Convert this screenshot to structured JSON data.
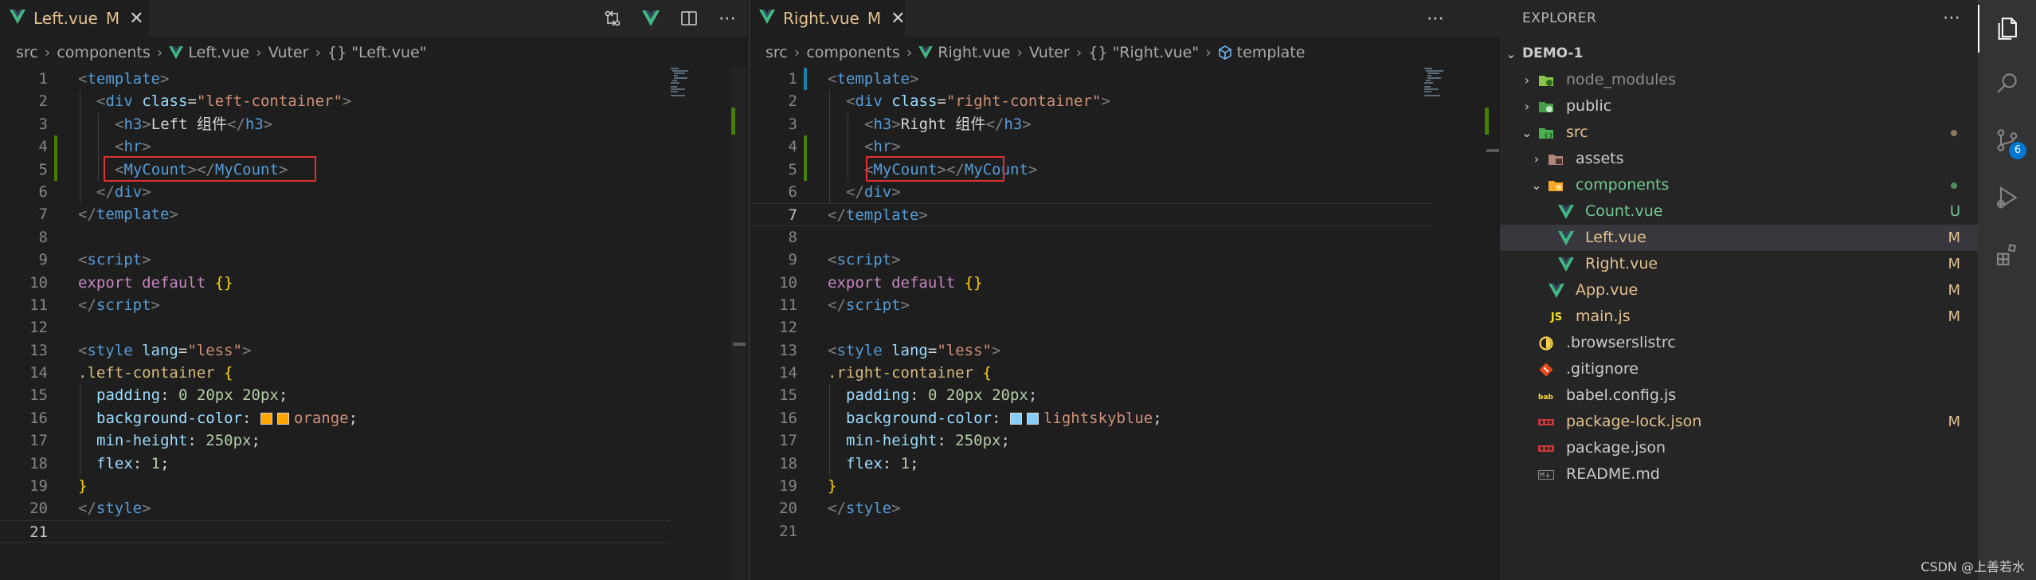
{
  "left_editor": {
    "tab": {
      "filename": "Left.vue",
      "status": "M",
      "close": "✕"
    },
    "actions_more": "⋯",
    "breadcrumb": {
      "src": "src",
      "components": "components",
      "file": "Left.vue",
      "vuter": "Vuter",
      "symbol_brace": "{}",
      "symbol": "\"Left.vue\""
    },
    "line_numbers": [
      "1",
      "2",
      "3",
      "4",
      "5",
      "6",
      "7",
      "8",
      "9",
      "10",
      "11",
      "12",
      "13",
      "14",
      "15",
      "16",
      "17",
      "18",
      "19",
      "20",
      "21"
    ],
    "code": {
      "l1": {
        "p1": "<",
        "tag": "template",
        "p2": ">"
      },
      "l2": {
        "p1": "<",
        "tag": "div",
        "attr": "class",
        "eq": "=",
        "val": "\"left-container\"",
        "p2": ">"
      },
      "l3": {
        "p1": "<",
        "tag": "h3",
        "p2": ">",
        "text": "Left 组件",
        "p3": "</",
        "tag2": "h3",
        "p4": ">"
      },
      "l4": {
        "p1": "<",
        "tag": "hr",
        "p2": ">"
      },
      "l5": {
        "p1": "<",
        "tag": "MyCount",
        "p2": "></",
        "tag2": "MyCount",
        "p3": ">"
      },
      "l6": {
        "p1": "</",
        "tag": "div",
        "p2": ">"
      },
      "l7": {
        "p1": "</",
        "tag": "template",
        "p2": ">"
      },
      "l9": {
        "p1": "<",
        "tag": "script",
        "p2": ">"
      },
      "l10": {
        "k1": "export",
        "k2": "default",
        "brace": "{}"
      },
      "l11": {
        "p1": "</",
        "tag": "script",
        "p2": ">"
      },
      "l13": {
        "p1": "<",
        "tag": "style",
        "attr": "lang",
        "eq": "=",
        "val": "\"less\"",
        "p2": ">"
      },
      "l14": {
        "sel": ".left-container",
        "brace": "{"
      },
      "l15": {
        "prop": "padding",
        "colon": ":",
        "v1": "0",
        "v2": "20px",
        "v3": "20px",
        "semi": ";"
      },
      "l16": {
        "prop": "background-color",
        "colon": ":",
        "val": "orange",
        "semi": ";"
      },
      "l17": {
        "prop": "min-height",
        "colon": ":",
        "val": "250px",
        "semi": ";"
      },
      "l18": {
        "prop": "flex",
        "colon": ":",
        "val": "1",
        "semi": ";"
      },
      "l19": {
        "brace": "}"
      },
      "l20": {
        "p1": "</",
        "tag": "style",
        "p2": ">"
      }
    },
    "swatch_color": "#ffa500"
  },
  "right_editor": {
    "tab": {
      "filename": "Right.vue",
      "status": "M",
      "close": "✕"
    },
    "actions_more": "⋯",
    "breadcrumb": {
      "src": "src",
      "components": "components",
      "file": "Right.vue",
      "vuter": "Vuter",
      "symbol_brace": "{}",
      "symbol": "\"Right.vue\"",
      "section": "template"
    },
    "line_numbers": [
      "1",
      "2",
      "3",
      "4",
      "5",
      "6",
      "7",
      "8",
      "9",
      "10",
      "11",
      "12",
      "13",
      "14",
      "15",
      "16",
      "17",
      "18",
      "19",
      "20",
      "21"
    ],
    "code": {
      "l1": {
        "p1": "<",
        "tag": "template",
        "p2": ">"
      },
      "l2": {
        "p1": "<",
        "tag": "div",
        "attr": "class",
        "eq": "=",
        "val": "\"right-container\"",
        "p2": ">"
      },
      "l3": {
        "p1": "<",
        "tag": "h3",
        "p2": ">",
        "text": "Right 组件",
        "p3": "</",
        "tag2": "h3",
        "p4": ">"
      },
      "l4": {
        "p1": "<",
        "tag": "hr",
        "p2": ">"
      },
      "l5": {
        "p1": "<",
        "tag": "MyCount",
        "p2": "></",
        "tag2": "MyCount",
        "p3": ">"
      },
      "l6": {
        "p1": "</",
        "tag": "div",
        "p2": ">"
      },
      "l7": {
        "p1": "</",
        "tag": "template",
        "p2": ">"
      },
      "l9": {
        "p1": "<",
        "tag": "script",
        "p2": ">"
      },
      "l10": {
        "k1": "export",
        "k2": "default",
        "brace": "{}"
      },
      "l11": {
        "p1": "</",
        "tag": "script",
        "p2": ">"
      },
      "l13": {
        "p1": "<",
        "tag": "style",
        "attr": "lang",
        "eq": "=",
        "val": "\"less\"",
        "p2": ">"
      },
      "l14": {
        "sel": ".right-container",
        "brace": "{"
      },
      "l15": {
        "prop": "padding",
        "colon": ":",
        "v1": "0",
        "v2": "20px",
        "v3": "20px",
        "semi": ";"
      },
      "l16": {
        "prop": "background-color",
        "colon": ":",
        "val": "lightskyblue",
        "semi": ";"
      },
      "l17": {
        "prop": "min-height",
        "colon": ":",
        "val": "250px",
        "semi": ";"
      },
      "l18": {
        "prop": "flex",
        "colon": ":",
        "val": "1",
        "semi": ";"
      },
      "l19": {
        "brace": "}"
      },
      "l20": {
        "p1": "</",
        "tag": "style",
        "p2": ">"
      }
    },
    "swatch_color": "#87cefa"
  },
  "explorer": {
    "title": "EXPLORER",
    "more": "⋯",
    "project": "DEMO-1",
    "items": [
      {
        "name": "node_modules",
        "badge": ""
      },
      {
        "name": "public",
        "badge": ""
      },
      {
        "name": "src",
        "badge": ""
      },
      {
        "name": "assets",
        "badge": ""
      },
      {
        "name": "components",
        "badge": ""
      },
      {
        "name": "Count.vue",
        "badge": "U"
      },
      {
        "name": "Left.vue",
        "badge": "M"
      },
      {
        "name": "Right.vue",
        "badge": "M"
      },
      {
        "name": "App.vue",
        "badge": "M"
      },
      {
        "name": "main.js",
        "badge": "M"
      },
      {
        "name": ".browserslistrc",
        "badge": ""
      },
      {
        "name": ".gitignore",
        "badge": ""
      },
      {
        "name": "babel.config.js",
        "badge": ""
      },
      {
        "name": "package-lock.json",
        "badge": "M"
      },
      {
        "name": "package.json",
        "badge": ""
      },
      {
        "name": "README.md",
        "badge": ""
      }
    ],
    "js_label": "JS"
  },
  "activity_bar": {
    "items": [
      "explorer-icon",
      "search-icon",
      "source-control-icon",
      "run-debug-icon",
      "extensions-icon"
    ],
    "scm_badge": "6"
  },
  "watermark": "CSDN @上善若水",
  "colors": {
    "modified": "#e2c08d",
    "untracked": "#73c991",
    "ignored": "#8c8c8c",
    "vue_green": "#41b883",
    "highlight_box": "#e03131"
  }
}
